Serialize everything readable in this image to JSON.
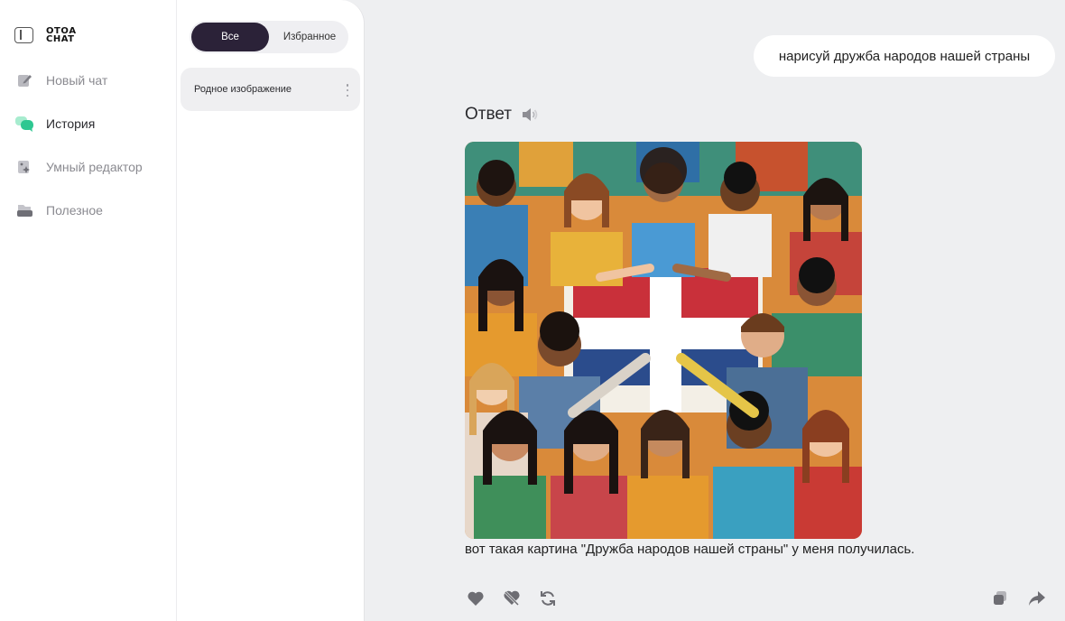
{
  "sidebar": {
    "logo_line1": "ОТОА",
    "logo_line2": "CHAT",
    "items": [
      {
        "label": "Новый чат",
        "icon": "pencil-icon"
      },
      {
        "label": "История",
        "icon": "chat-bubbles-icon",
        "active": true
      },
      {
        "label": "Умный редактор",
        "icon": "smart-editor-icon"
      },
      {
        "label": "Полезное",
        "icon": "toolbox-icon"
      }
    ]
  },
  "history": {
    "filter_all": "Все",
    "filter_favorites": "Избранное",
    "items": [
      {
        "title": "Родное изображение"
      }
    ]
  },
  "chat": {
    "user_message": "нарисуй дружба народов нашей страны",
    "answer_title": "Ответ",
    "answer_text": "вот такая картина \"Дружба народов нашей страны\" у меня получилась.",
    "actions": [
      "heart-icon",
      "dislike-icon",
      "regenerate-icon",
      "copy-icon",
      "share-icon"
    ]
  },
  "colors": {
    "accent_dark": "#2b2238",
    "active_green": "#3dd6a0",
    "background": "#eeeff1"
  }
}
